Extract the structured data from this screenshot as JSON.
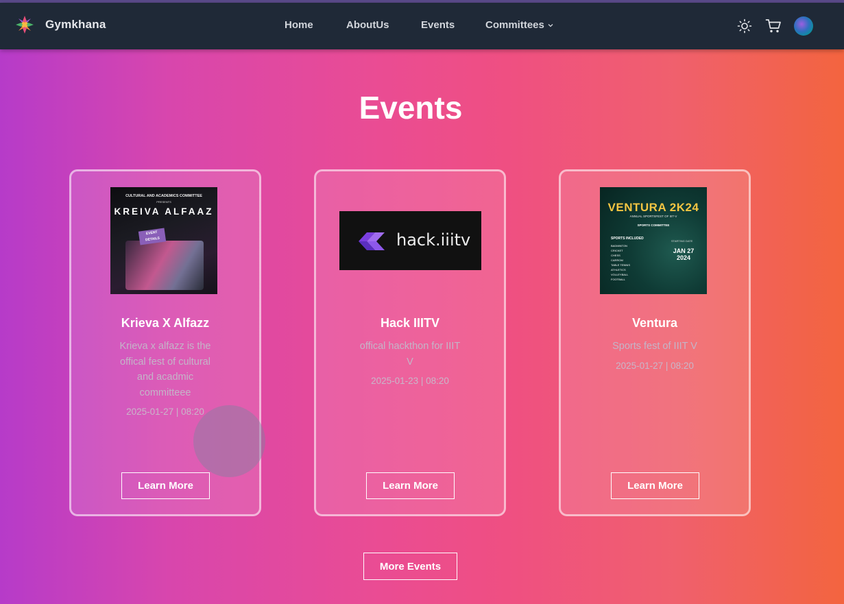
{
  "navbar": {
    "brand": "Gymkhana",
    "links": {
      "home": "Home",
      "about": "AboutUs",
      "events": "Events",
      "committees": "Committees"
    },
    "icons": [
      "theme-toggle-icon",
      "cart-icon",
      "avatar"
    ]
  },
  "page": {
    "title": "Events",
    "more_button": "More Events"
  },
  "cards": [
    {
      "title": "Krieva X Alfazz",
      "description": "Krieva x alfazz is the offical fest of cultural and acadmic committeee",
      "date": "2025-01-27 | 08:20",
      "button": "Learn More",
      "poster": {
        "top": "CULTURAL AND ACADEMICS COMMITTEE",
        "sub": "PRESENTS",
        "main": "KREIVA ALFAAZ",
        "tag": "EVENT DETAILS"
      }
    },
    {
      "title": "Hack IIITV",
      "description": "offical hackthon for IIIT V",
      "date": "2025-01-23 | 08:20",
      "button": "Learn More",
      "poster": {
        "logo_text": "hack.iiitv"
      }
    },
    {
      "title": "Ventura",
      "description": "Sports fest of IIIT V",
      "date": "2025-01-27 | 08:20",
      "button": "Learn More",
      "poster": {
        "title": "VENTURA 2K24",
        "sub": "ANNUAL SPORTSFEST OF IIIT-V",
        "sub2": "SPORTS COMMITTEE",
        "included": "SPORTS INCLUDED",
        "sports": [
          "BADMINTON",
          "CRICKET",
          "CHESS",
          "CARROM",
          "TABLE TENNIS",
          "ATHLETICS",
          "VOLLEYBALL",
          "FOOTBALL"
        ],
        "starting_label": "STARTING DATE",
        "start_date": "JAN 27 2024"
      }
    }
  ],
  "colors": {
    "navbar": "#1f2937",
    "gradient_start": "#b63bc9",
    "gradient_mid": "#ea4c93",
    "gradient_end": "#f3643f"
  }
}
